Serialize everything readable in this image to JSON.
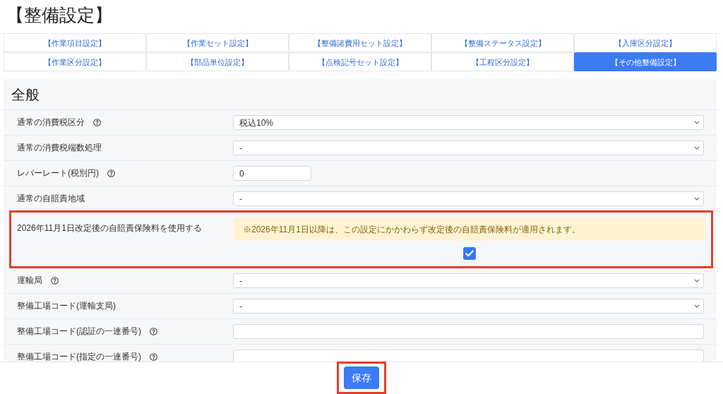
{
  "page": {
    "title": "【整備設定】"
  },
  "tabs": [
    {
      "label": "【作業項目設定】",
      "selected": false
    },
    {
      "label": "【作業セット設定】",
      "selected": false
    },
    {
      "label": "【整備諸費用セット設定】",
      "selected": false
    },
    {
      "label": "【整備ステータス設定】",
      "selected": false
    },
    {
      "label": "【入庫区分設定】",
      "selected": false
    },
    {
      "label": "【作業区分設定】",
      "selected": false
    },
    {
      "label": "【部品単位設定】",
      "selected": false
    },
    {
      "label": "【点検記号セット設定】",
      "selected": false
    },
    {
      "label": "【工程区分設定】",
      "selected": false
    },
    {
      "label": "【その他整備設定】",
      "selected": true
    }
  ],
  "section": {
    "title": "全般",
    "rows": [
      {
        "kind": "select",
        "label": "通常の消費税区分",
        "help": true,
        "value": "税込10%",
        "highlighted": false
      },
      {
        "kind": "select",
        "label": "通常の消費税端数処理",
        "help": false,
        "value": "-",
        "highlighted": false
      },
      {
        "kind": "number",
        "label": "レバーレート(税別円)",
        "help": true,
        "value": "0",
        "highlighted": false
      },
      {
        "kind": "select",
        "label": "通常の自賠責地域",
        "help": false,
        "value": "-",
        "highlighted": false
      },
      {
        "kind": "checkbox",
        "label": "2026年11月1日改定後の自賠責保険料を使用する",
        "help": false,
        "notice": "※2026年11月1日以降は、この設定にかかわらず改定後の自賠責保険料が適用されます。",
        "checked": true,
        "highlighted": true
      },
      {
        "kind": "select",
        "label": "運輸局",
        "help": true,
        "value": "-",
        "highlighted": false
      },
      {
        "kind": "select",
        "label": "整備工場コード(運輸支局)",
        "help": false,
        "value": "-",
        "highlighted": false
      },
      {
        "kind": "text",
        "label": "整備工場コード(認証の一連番号)",
        "help": true,
        "highlighted": false
      },
      {
        "kind": "text",
        "label": "整備工場コード(指定の一連番号)",
        "help": true,
        "highlighted": false
      }
    ]
  },
  "save_button": {
    "label": "保存",
    "highlighted": true
  }
}
